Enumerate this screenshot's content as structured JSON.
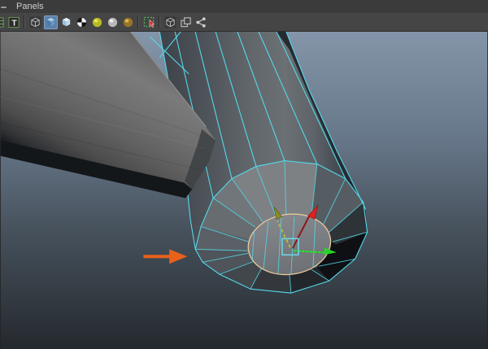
{
  "menu_bar": {
    "items": [
      {
        "label": "Panels"
      }
    ]
  },
  "toolbar": {
    "items": [
      {
        "type": "grid",
        "name": "camera-grid",
        "partial": true
      },
      {
        "type": "text_t",
        "name": "text-tool",
        "label": "T"
      },
      {
        "type": "separator"
      },
      {
        "type": "cube_wire",
        "name": "wireframe-cube"
      },
      {
        "type": "cube_blue",
        "name": "shaded-cube",
        "active": true
      },
      {
        "type": "cube_light",
        "name": "textured-cube"
      },
      {
        "type": "checker",
        "name": "checker-sphere"
      },
      {
        "type": "ball_yellow",
        "name": "default-light-sphere"
      },
      {
        "type": "ball_white",
        "name": "white-light-sphere"
      },
      {
        "type": "ball_gold",
        "name": "gold-material-sphere"
      },
      {
        "type": "separator"
      },
      {
        "type": "marquee",
        "name": "marquee-select"
      },
      {
        "type": "separator"
      },
      {
        "type": "cube_wire",
        "name": "isolate-cube"
      },
      {
        "type": "squares",
        "name": "overlapping-squares"
      },
      {
        "type": "share",
        "name": "share-nodes"
      }
    ]
  },
  "viewport": {
    "selected_object": "polygon-cylinder-mesh",
    "selection_mode": "face",
    "manipulator": {
      "tool": "move",
      "axes": [
        {
          "axis": "x",
          "color": "#e02020",
          "style": "solid"
        },
        {
          "axis": "y",
          "color": "#2ae02a",
          "style": "dotted"
        },
        {
          "axis": "z",
          "color": "#b9b838",
          "style": "dashed"
        }
      ],
      "center_handle_color": "#6cd9ea"
    }
  },
  "theme": {
    "menubar_bg": "#3b3b3b",
    "toolbar_bg": "#454545",
    "bg_top": "#8495a9",
    "bg_mid1": "#69798c",
    "bg_mid2": "#47525d",
    "bg_bottom": "#24292e",
    "wireframe": "#54d8ea",
    "face_outline": "#eeca9f",
    "axis_x": "#e02020",
    "axis_x_line": "#8a1818",
    "axis_y": "#2ae02a",
    "axis_z": "#b9b838",
    "manip_center": "#6cd9ea",
    "annotation": "#e8611a"
  }
}
